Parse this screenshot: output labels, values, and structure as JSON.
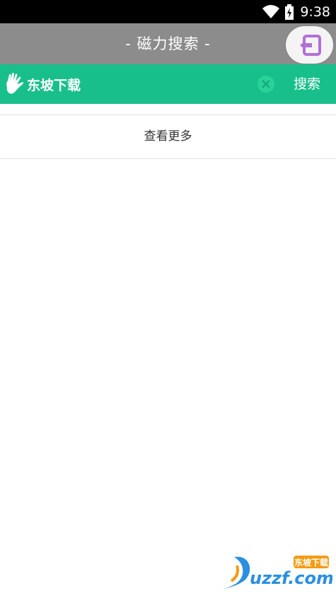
{
  "status_bar": {
    "time": "9:38"
  },
  "header": {
    "title": "-  磁力搜索  -"
  },
  "search_bar": {
    "brand": "东坡下载",
    "search_label": "搜索"
  },
  "results": {
    "view_more_label": "查看更多"
  },
  "watermark": {
    "text": "uzzf.com",
    "cn": "东坡下载"
  },
  "colors": {
    "accent": "#19bf8b",
    "header_bg": "#8c8c8c",
    "exit_icon": "#b36ed8"
  }
}
